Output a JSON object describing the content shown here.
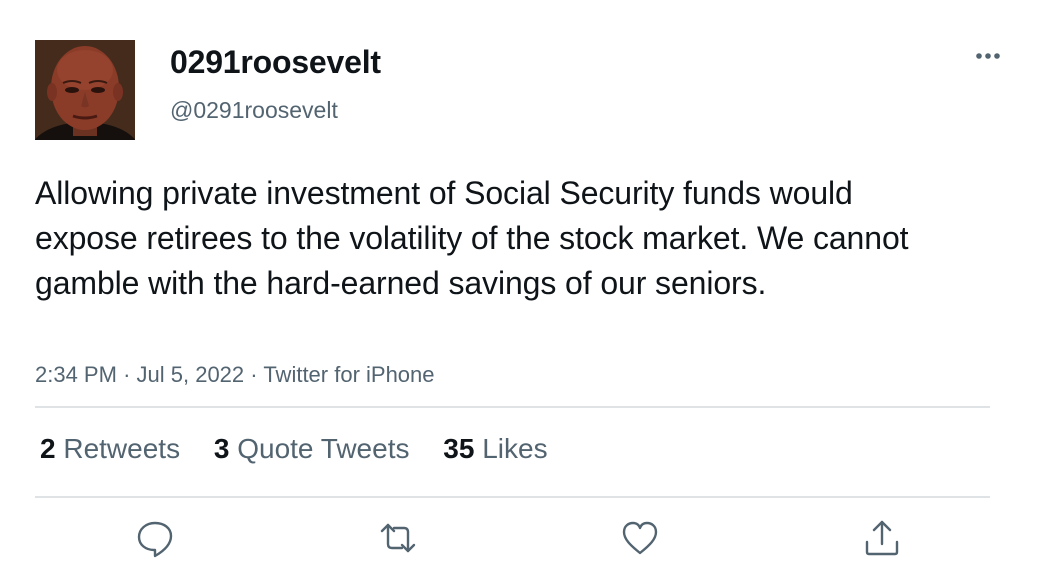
{
  "author": {
    "display_name": "0291roosevelt",
    "handle": "@0291roosevelt",
    "avatar_icon": "profile-photo"
  },
  "tweet": {
    "text": "Allowing private investment of Social Security funds would expose retirees to the volatility of the stock market. We cannot gamble with the hard-earned savings of our seniors.",
    "time": "2:34 PM",
    "separator": "·",
    "date": "Jul 5, 2022",
    "source": "Twitter for iPhone"
  },
  "stats": {
    "retweets_count": "2",
    "retweets_label": "Retweets",
    "quotes_count": "3",
    "quotes_label": "Quote Tweets",
    "likes_count": "35",
    "likes_label": "Likes"
  },
  "actions": {
    "reply_icon": "reply-icon",
    "retweet_icon": "retweet-icon",
    "like_icon": "heart-icon",
    "share_icon": "share-icon",
    "more_icon": "more-icon"
  },
  "colors": {
    "text_primary": "#0f1419",
    "text_secondary": "#536471",
    "icon": "#536471",
    "divider": "#dfe3e6"
  }
}
